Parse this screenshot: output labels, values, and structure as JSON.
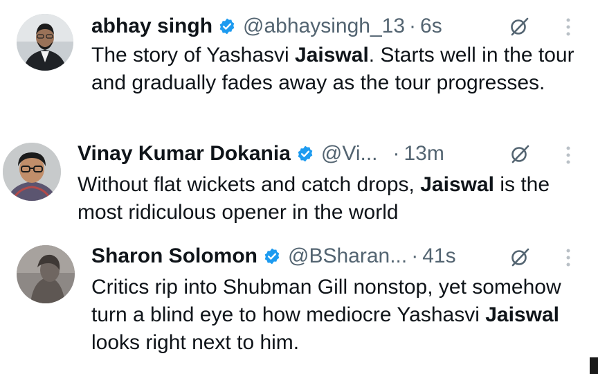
{
  "tweets": [
    {
      "name": "abhay singh",
      "handle": "@abhaysingh_13",
      "separator": "·",
      "time": "6s",
      "text_parts": [
        "The story of Yashasvi ",
        "Jaiswal",
        ". Starts well in the tour and gradually fades away as the tour progresses."
      ],
      "avatar_icon": "avatar-man-suit",
      "verified_icon": "verified-badge-icon"
    },
    {
      "name": "Vinay Kumar Dokania",
      "handle": "@Vi...",
      "separator": "·",
      "time": "13m",
      "text_parts": [
        "Without flat wickets and catch drops, ",
        "Jaiswal",
        " is the most ridiculous opener in the world"
      ],
      "avatar_icon": "avatar-man-glasses",
      "verified_icon": "verified-badge-icon"
    },
    {
      "name": "Sharon Solomon",
      "handle": "@BSharan...",
      "separator": "·",
      "time": "41s",
      "text_parts": [
        "Critics rip into Shubman Gill nonstop, yet somehow turn a blind eye to how mediocre Yashasvi ",
        "Jaiswal",
        " looks right next to him."
      ],
      "avatar_icon": "avatar-grey-photo",
      "verified_icon": "verified-badge-icon"
    }
  ],
  "colors": {
    "verified": "#1d9bf0",
    "secondary_text": "#536471",
    "primary_text": "#0f1419"
  }
}
